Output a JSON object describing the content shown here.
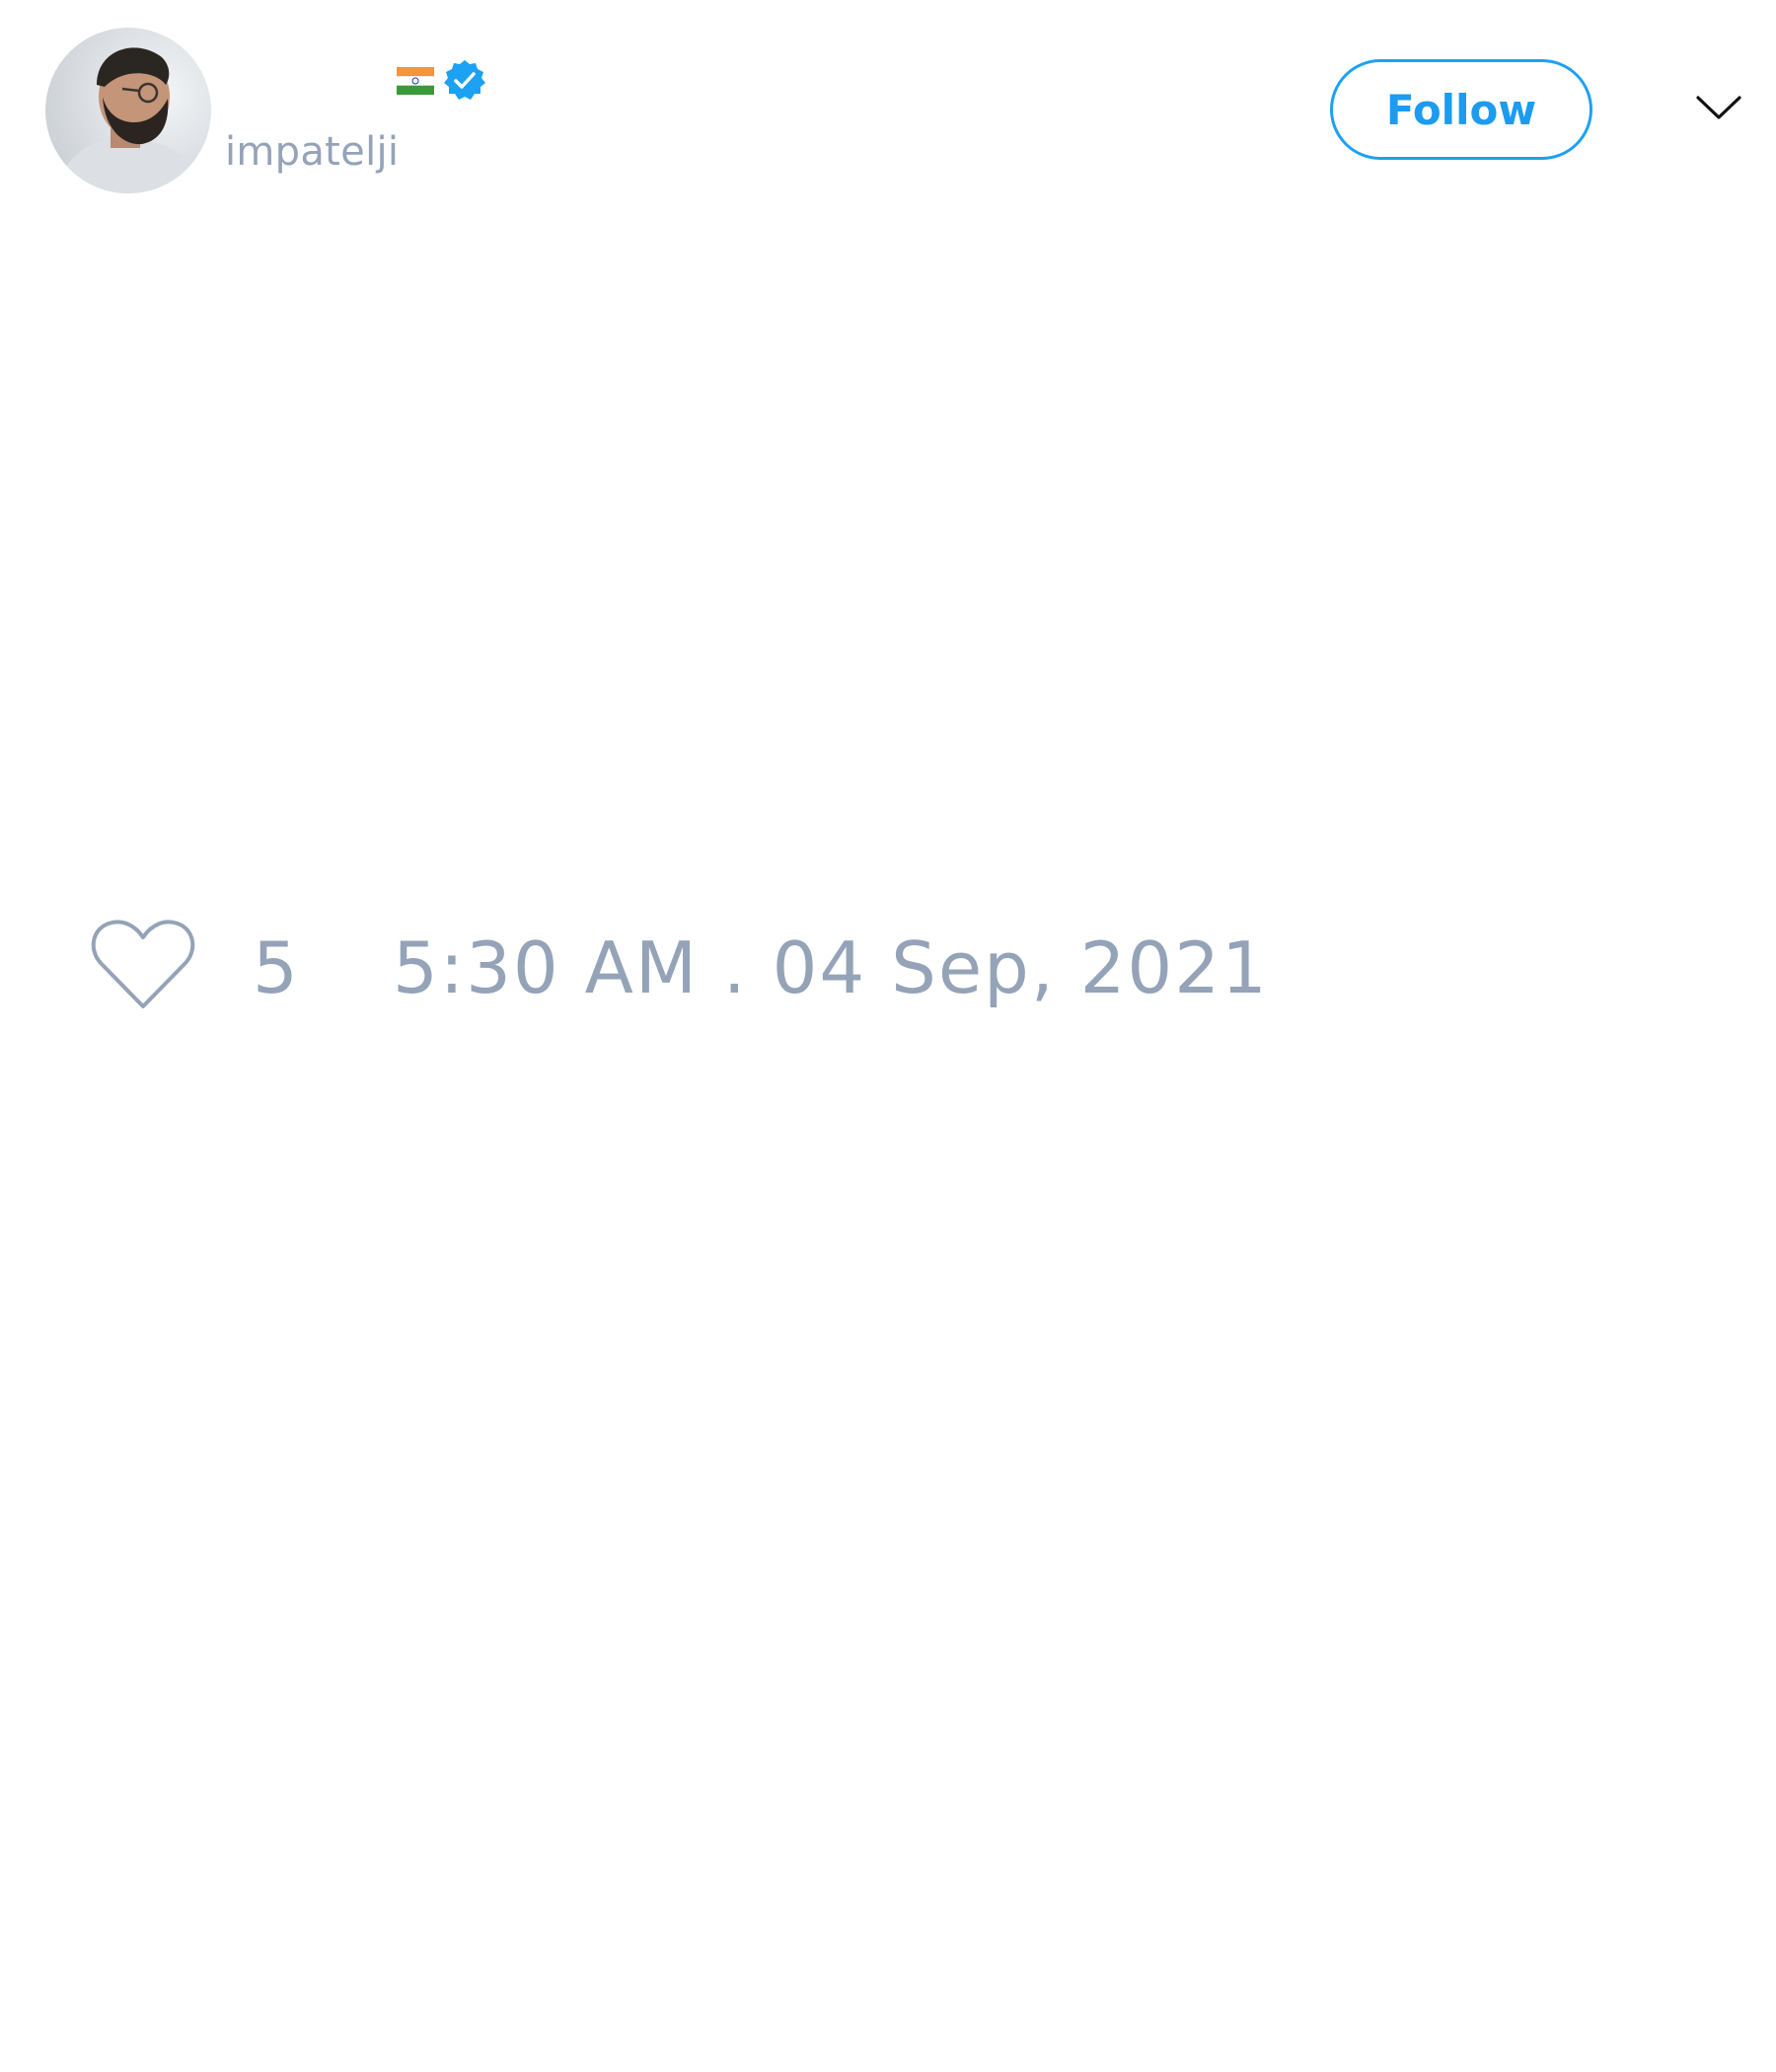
{
  "tweet": {
    "author": {
      "handle": "impatelji",
      "flag_icon": "india-flag-icon",
      "verified_icon": "verified-badge-icon",
      "verified_color": "#1da1f2"
    },
    "follow_label": "Follow",
    "menu_icon": "chevron-down-icon",
    "like_icon": "heart-outline-icon",
    "like_count": "5",
    "timestamp": "5:30 AM . 04 Sep, 2021",
    "colors": {
      "accent": "#1da1f2",
      "muted_text": "#94a3b8",
      "background": "#ffffff"
    }
  }
}
